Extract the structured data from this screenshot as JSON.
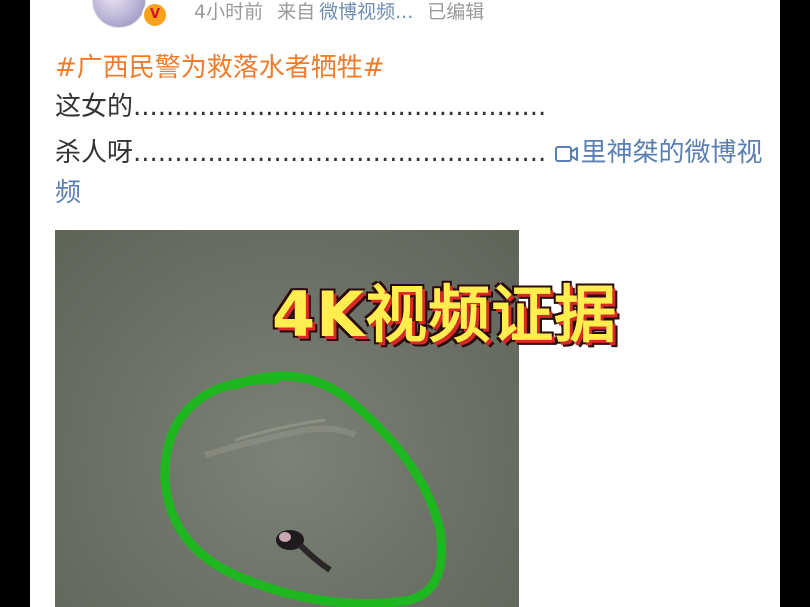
{
  "post": {
    "time": "4小时前",
    "source_prefix": "来自",
    "source": "微博视频...",
    "edited": "已编辑",
    "hashtag": "#广西民警为救落水者牺牲#",
    "line1": "这女的..................................................",
    "line2": "杀人呀..................................................",
    "link_text": "里神桀的微博视",
    "link_text_wrap": "频"
  },
  "video": {
    "overlay_caption": "4K视频证据"
  },
  "colors": {
    "hashtag": "#ee7c2c",
    "link": "#5a7fb3",
    "highlight_circle": "#1fb71f",
    "caption": "#ffee4d"
  },
  "icons": [
    "verified-badge-icon",
    "video-link-icon"
  ]
}
